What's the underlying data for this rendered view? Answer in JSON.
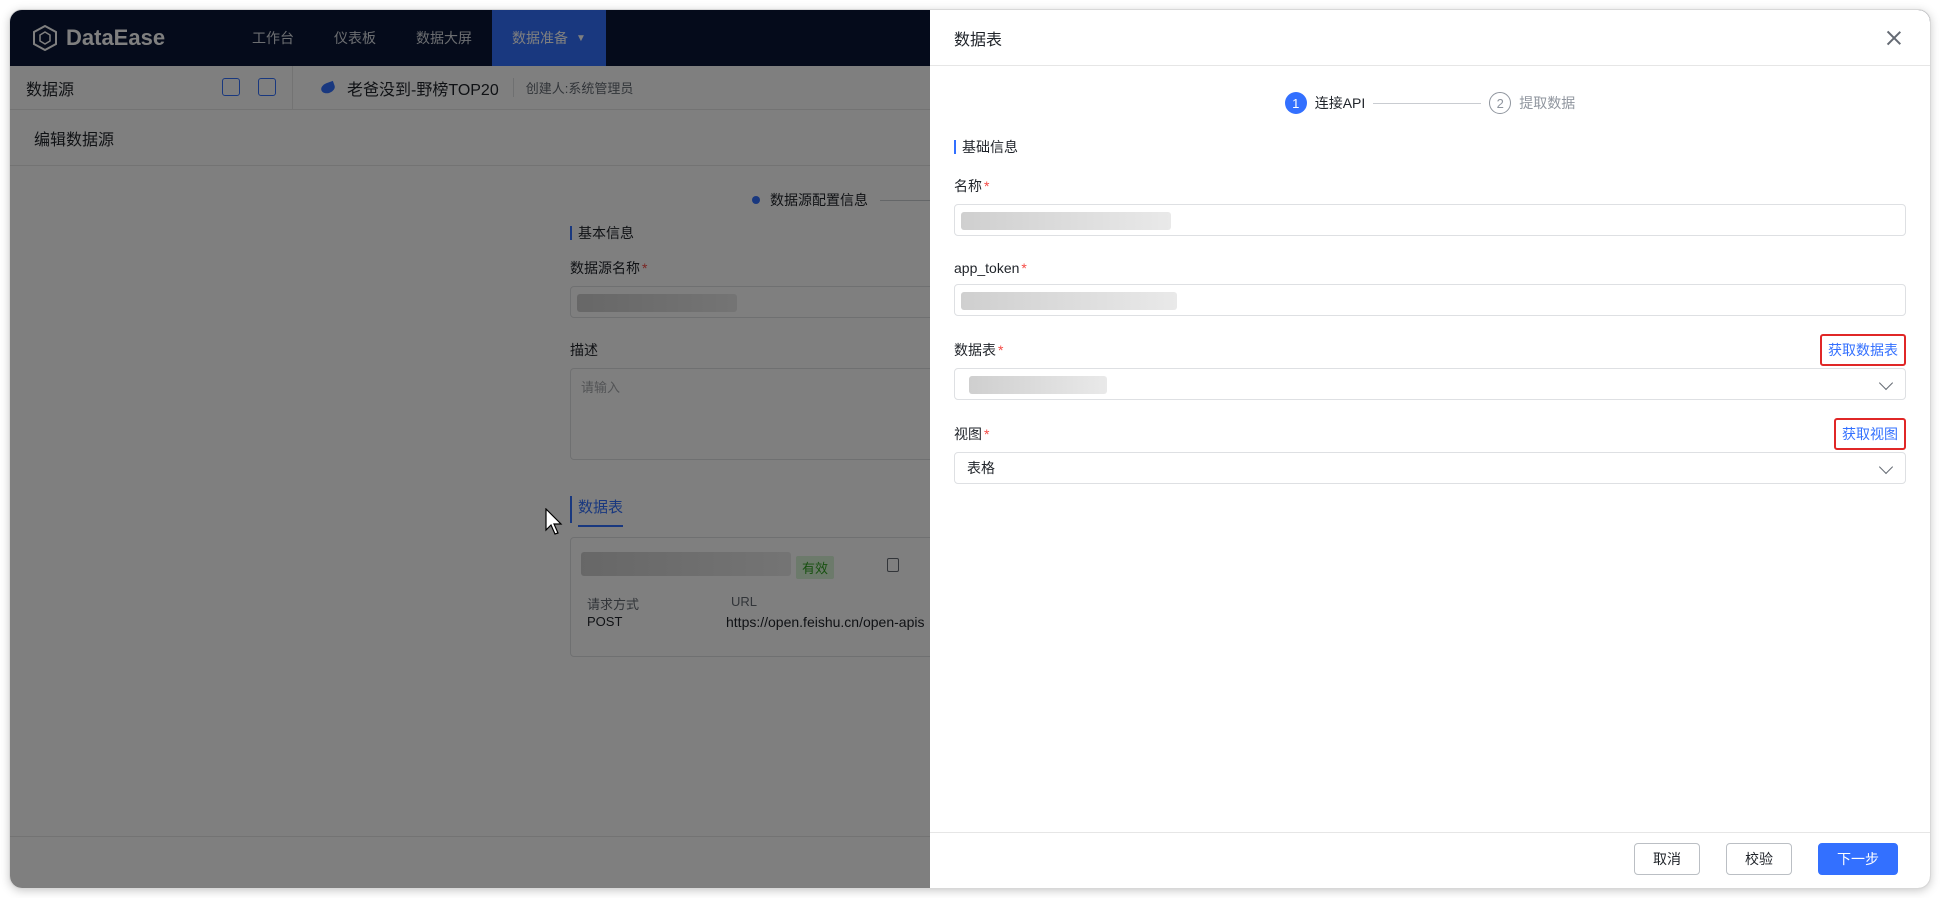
{
  "app": {
    "logo": "DataEase",
    "nav": [
      "工作台",
      "仪表板",
      "数据大屏",
      "数据准备"
    ],
    "nav_active": "数据准备"
  },
  "subbar": {
    "section": "数据源",
    "dataset_name": "老爸没到-野榜TOP20",
    "creator": "创建人:系统管理员"
  },
  "editor": {
    "title": "编辑数据源",
    "step": "数据源配置信息",
    "basic_info": "基本信息",
    "name_label": "数据源名称",
    "desc_label": "描述",
    "desc_placeholder": "请输入",
    "tab": "数据表",
    "api_status": "有效",
    "method_label": "请求方式",
    "url_label": "URL",
    "method_value": "POST",
    "url_value": "https://open.feishu.cn/open-apis"
  },
  "drawer": {
    "title": "数据表",
    "steps": [
      {
        "num": "1",
        "label": "连接API"
      },
      {
        "num": "2",
        "label": "提取数据"
      }
    ],
    "section": "基础信息",
    "fields": {
      "name_label": "名称",
      "token_label": "app_token",
      "table_label": "数据表",
      "view_label": "视图",
      "view_value": "表格"
    },
    "links": {
      "fetch_tables": "获取数据表",
      "fetch_views": "获取视图"
    },
    "buttons": {
      "cancel": "取消",
      "validate": "校验",
      "next": "下一步"
    }
  },
  "colors": {
    "primary": "#3370ff",
    "nav_bg": "#0b1736",
    "highlight": "#e02727",
    "valid": "#2ea121"
  }
}
